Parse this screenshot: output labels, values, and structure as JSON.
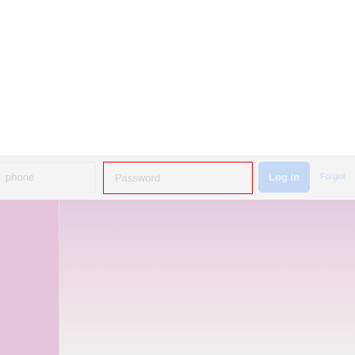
{
  "login_bar": {
    "identifier_placeholder": "phone",
    "password_placeholder": "Password",
    "login_label": "Log in",
    "forgot_label": "Forgot"
  },
  "colors": {
    "login_button": "#c5d8f5",
    "highlight": "#ff0000",
    "panel": "#e5c5dc"
  }
}
